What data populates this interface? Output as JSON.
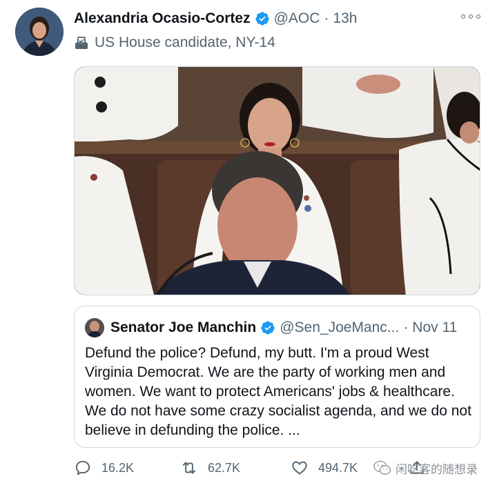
{
  "tweet": {
    "author": {
      "display_name": "Alexandria Ocasio-Cortez",
      "handle": "@AOC",
      "separator": "·",
      "time": "13h",
      "avatar_icon": "profile-photo",
      "verified_icon": "verified-badge-icon"
    },
    "label": {
      "icon": "ballot-box-icon",
      "text": "US House candidate, NY-14"
    },
    "media": {
      "kind": "photo"
    },
    "quote": {
      "author": {
        "display_name": "Senator Joe Manchin",
        "handle": "@Sen_JoeManc...",
        "separator": "·",
        "time": "Nov 11"
      },
      "text": "Defund the police? Defund, my butt. I'm a proud West Virginia Democrat. We are the party of working men and women. We want to protect Americans' jobs & healthcare. We do not have some crazy socialist agenda, and we do not believe in defunding the police. ..."
    },
    "actions": {
      "reply_count": "16.2K",
      "retweet_count": "62.7K",
      "like_count": "494.7K"
    },
    "watermark": "闲吃客的随想录"
  },
  "colors": {
    "verified_blue": "#1d9bf0",
    "secondary_text": "#536471",
    "border": "#cfd9de"
  }
}
